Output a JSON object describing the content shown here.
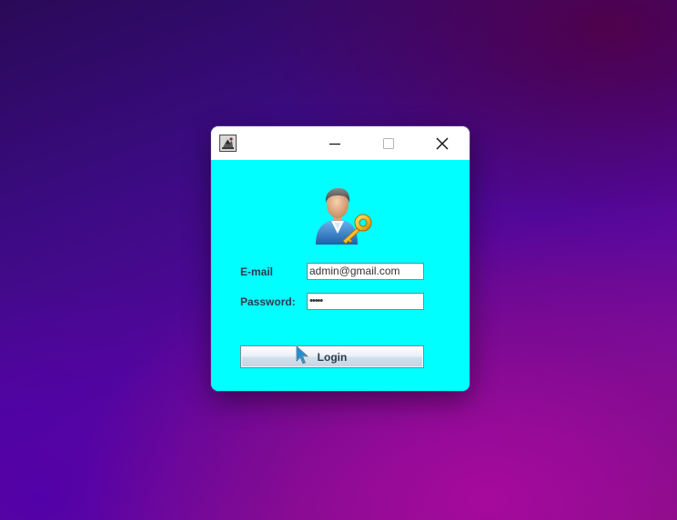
{
  "window": {
    "titlebar": {
      "app_icon": "java-app-icon",
      "minimize_icon": "minimize-icon",
      "maximize_icon": "maximize-icon",
      "close_icon": "close-icon"
    },
    "avatar_icon": "user-key-icon",
    "form": {
      "email_label": "E-mail",
      "email_value": "admin@gmail.com",
      "password_label": "Password:",
      "password_value": "•••••",
      "login_label": "Login"
    }
  },
  "colors": {
    "client_background": "#00ffff",
    "titlebar_background": "#ffffff"
  }
}
